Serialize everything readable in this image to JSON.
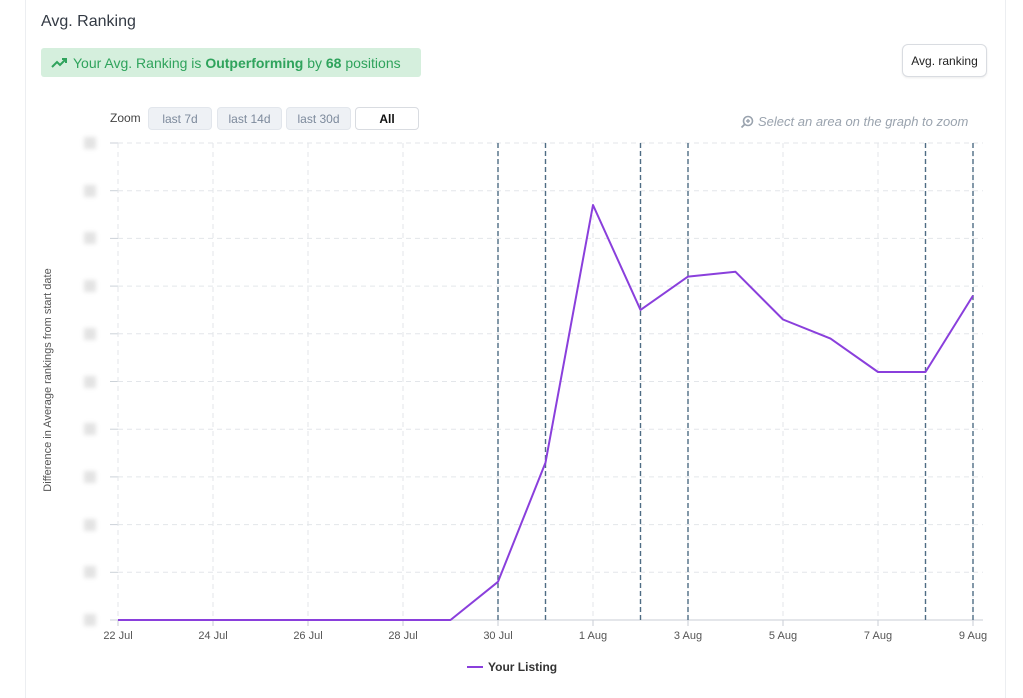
{
  "panel": {
    "title": "Avg. Ranking",
    "banner": {
      "prefix": "Your Avg. Ranking is",
      "status": "Outperforming",
      "middle": "by",
      "count": "68",
      "suffix": "positions",
      "icon": "trending-up-icon"
    },
    "avg_ranking_button": "Avg. ranking"
  },
  "zoom": {
    "label": "Zoom",
    "options": [
      "last 7d",
      "last 14d",
      "last 30d",
      "All"
    ],
    "active": "All",
    "hint": "Select an area on the graph to zoom"
  },
  "colors": {
    "series": "#8a3fdc",
    "banner_bg": "#d5efdd",
    "banner_text": "#2fa35c",
    "marker_lines": "#4e6c84"
  },
  "chart_data": {
    "type": "line",
    "ylabel": "Difference in Average rankings from start date",
    "xlabel": "",
    "x_tick_labels": [
      "22 Jul",
      "24 Jul",
      "26 Jul",
      "28 Jul",
      "30 Jul",
      "1 Aug",
      "3 Aug",
      "5 Aug",
      "7 Aug",
      "9 Aug"
    ],
    "x_tick_dates": [
      "2024-07-22",
      "2024-07-24",
      "2024-07-26",
      "2024-07-28",
      "2024-07-30",
      "2024-08-01",
      "2024-08-03",
      "2024-08-05",
      "2024-08-07",
      "2024-08-09"
    ],
    "x_range": [
      "2024-07-22",
      "2024-08-09"
    ],
    "y_tick_values": [
      0,
      10,
      20,
      30,
      40,
      50,
      60,
      70,
      80,
      90,
      100
    ],
    "y_tick_labels_visible": false,
    "ylim": [
      0,
      100
    ],
    "grid": true,
    "legend_position": "bottom",
    "vertical_markers": [
      "2024-07-30",
      "2024-07-31",
      "2024-08-02",
      "2024-08-03",
      "2024-08-08",
      "2024-08-09"
    ],
    "series": [
      {
        "name": "Your Listing",
        "x": [
          "2024-07-22",
          "2024-07-29",
          "2024-07-30",
          "2024-07-31",
          "2024-08-01",
          "2024-08-02",
          "2024-08-03",
          "2024-08-04",
          "2024-08-05",
          "2024-08-06",
          "2024-08-07",
          "2024-08-08",
          "2024-08-09"
        ],
        "values": [
          0,
          0,
          8,
          33,
          87,
          65,
          72,
          73,
          63,
          59,
          52,
          52,
          68
        ]
      }
    ]
  }
}
